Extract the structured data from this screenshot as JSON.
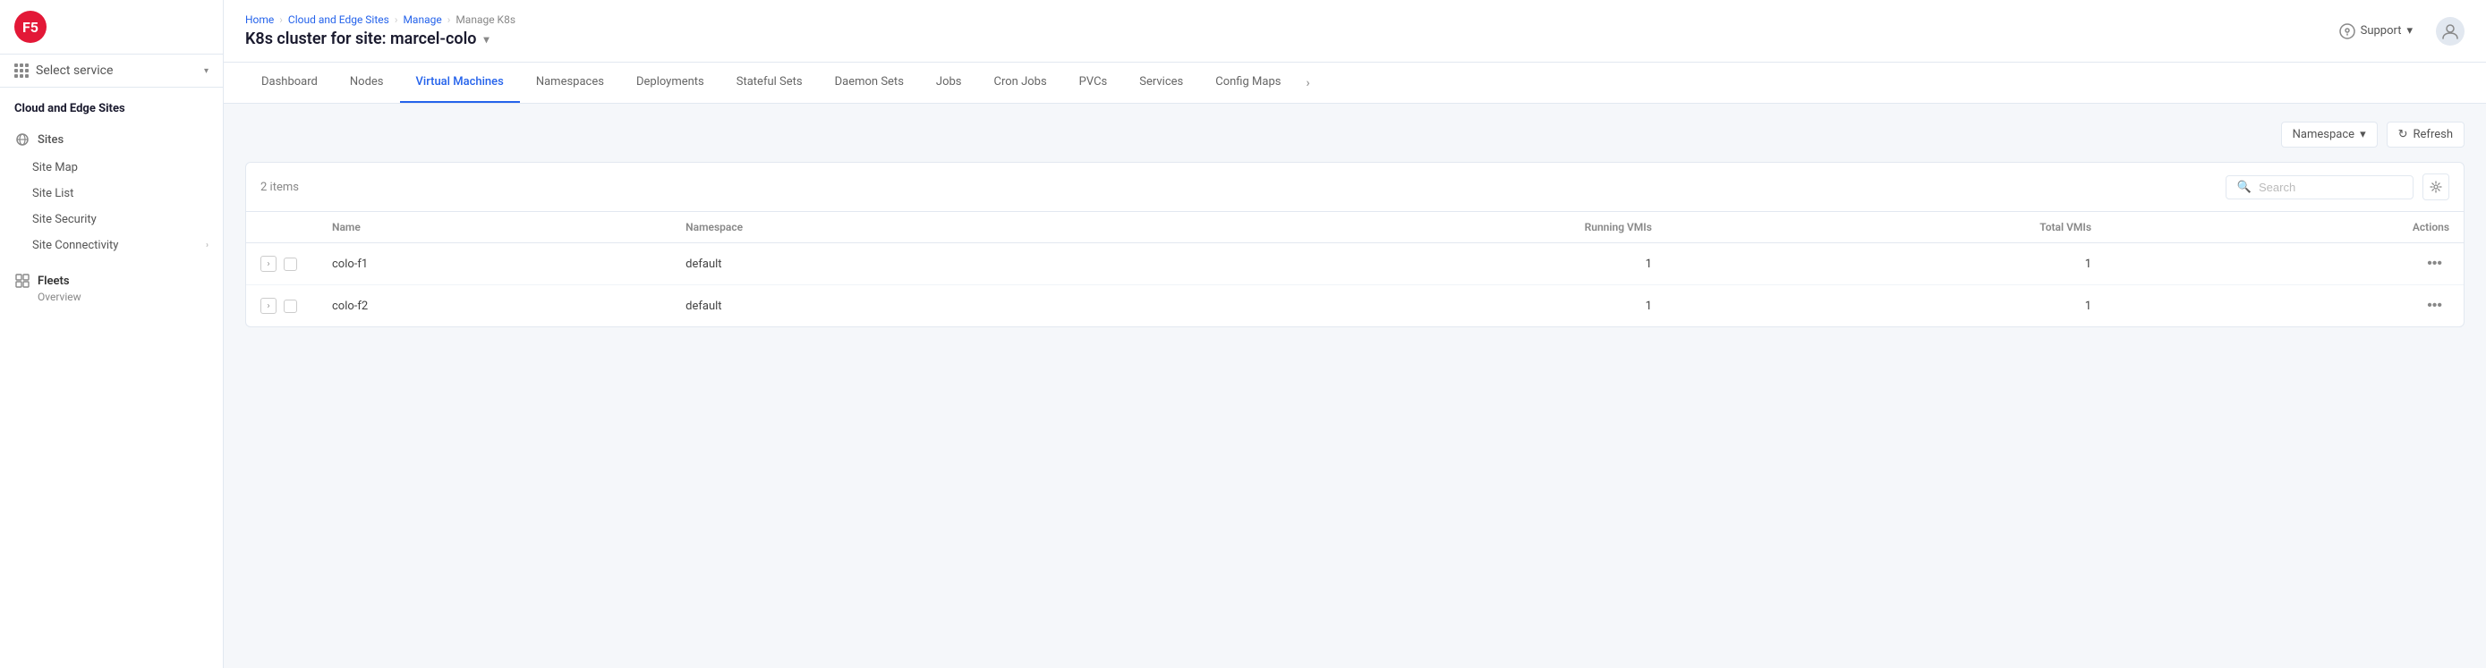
{
  "brand": {
    "logo_text": "F5"
  },
  "service_selector": {
    "label": "Select service",
    "chevron": "▾"
  },
  "sidebar": {
    "section_title": "Cloud and Edge Sites",
    "sites_group": {
      "label": "Sites",
      "items": [
        {
          "id": "site-map",
          "label": "Site Map"
        },
        {
          "id": "site-list",
          "label": "Site List"
        },
        {
          "id": "site-security",
          "label": "Site Security"
        },
        {
          "id": "site-connectivity",
          "label": "Site Connectivity"
        }
      ]
    },
    "fleets_group": {
      "label": "Fleets",
      "sub_label": "Overview"
    }
  },
  "top_bar": {
    "breadcrumb": {
      "items": [
        "Home",
        "Cloud and Edge Sites",
        "Manage",
        "Manage K8s"
      ]
    },
    "page_title": "K8s cluster for site: marcel-colo",
    "support_label": "Support",
    "chevron": "▾"
  },
  "tabs": {
    "items": [
      {
        "id": "dashboard",
        "label": "Dashboard"
      },
      {
        "id": "nodes",
        "label": "Nodes"
      },
      {
        "id": "virtual-machines",
        "label": "Virtual Machines",
        "active": true
      },
      {
        "id": "namespaces",
        "label": "Namespaces"
      },
      {
        "id": "deployments",
        "label": "Deployments"
      },
      {
        "id": "stateful-sets",
        "label": "Stateful Sets"
      },
      {
        "id": "daemon-sets",
        "label": "Daemon Sets"
      },
      {
        "id": "jobs",
        "label": "Jobs"
      },
      {
        "id": "cron-jobs",
        "label": "Cron Jobs"
      },
      {
        "id": "pvcs",
        "label": "PVCs"
      },
      {
        "id": "services",
        "label": "Services"
      },
      {
        "id": "config-maps",
        "label": "Config Maps"
      }
    ],
    "more_icon": "›"
  },
  "toolbar": {
    "namespace_label": "Namespace",
    "namespace_chevron": "▾",
    "refresh_label": "Refresh",
    "refresh_icon": "↻"
  },
  "table": {
    "items_count": "2 items",
    "search_placeholder": "Search",
    "columns": [
      {
        "id": "name",
        "label": "Name"
      },
      {
        "id": "namespace",
        "label": "Namespace"
      },
      {
        "id": "running-vmis",
        "label": "Running VMIs"
      },
      {
        "id": "total-vmis",
        "label": "Total VMIs"
      },
      {
        "id": "actions",
        "label": "Actions"
      }
    ],
    "rows": [
      {
        "id": "row-1",
        "name": "colo-f1",
        "namespace": "default",
        "running_vmis": "1",
        "total_vmis": "1"
      },
      {
        "id": "row-2",
        "name": "colo-f2",
        "namespace": "default",
        "running_vmis": "1",
        "total_vmis": "1"
      }
    ]
  }
}
